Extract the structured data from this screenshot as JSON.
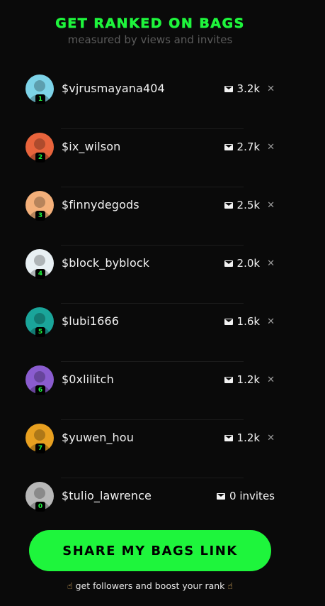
{
  "header": {
    "title": "GET RANKED ON BAGS",
    "subtitle": "measured by views and invites"
  },
  "colors": {
    "accent": "#1ef53c",
    "background": "#0a0a0a"
  },
  "leaderboard": [
    {
      "rank": "1",
      "handle": "$vjrusmayana404",
      "count": "3.2k",
      "avatar_color": "#7dd3e8"
    },
    {
      "rank": "2",
      "handle": "$ix_wilson",
      "count": "2.7k",
      "avatar_color": "#e8643c"
    },
    {
      "rank": "3",
      "handle": "$finnydegods",
      "count": "2.5k",
      "avatar_color": "#f4b07a"
    },
    {
      "rank": "4",
      "handle": "$block_byblock",
      "count": "2.0k",
      "avatar_color": "#e8f0f4"
    },
    {
      "rank": "5",
      "handle": "$lubi1666",
      "count": "1.6k",
      "avatar_color": "#1aa59a"
    },
    {
      "rank": "6",
      "handle": "$0xlilitch",
      "count": "1.2k",
      "avatar_color": "#8a5ccf"
    },
    {
      "rank": "7",
      "handle": "$yuwen_hou",
      "count": "1.2k",
      "avatar_color": "#e8a020"
    },
    {
      "rank": "0",
      "handle": "$tulio_lawrence",
      "count": "0 invites",
      "avatar_color": "#b8b8b8"
    }
  ],
  "icons": {
    "mail": "mail-icon",
    "x": "x-logo-icon",
    "hand": "pointing-hand-icon"
  },
  "share_button": {
    "label": "SHARE MY BAGS LINK"
  },
  "footer": {
    "text": "get followers and boost your rank"
  }
}
